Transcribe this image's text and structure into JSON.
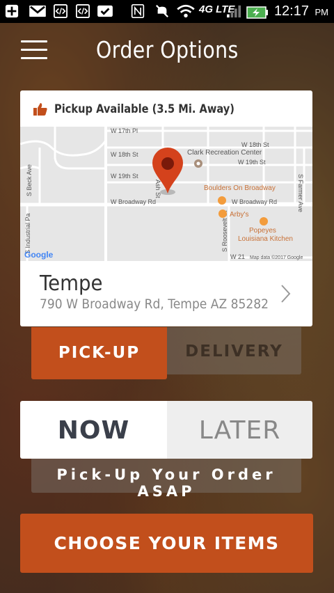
{
  "status_bar": {
    "time": "12:17",
    "ampm": "PM",
    "network": "4G LTE",
    "icons": [
      "add-icon",
      "gmail-icon",
      "code-icon",
      "code-icon",
      "check-icon",
      "nfc-icon",
      "mute-icon",
      "wifi-icon",
      "signal-icon",
      "battery-charging-icon"
    ]
  },
  "header": {
    "title": "Order Options",
    "menu_icon": "hamburger-menu-icon"
  },
  "card": {
    "availability": "Pickup Available (3.5 Mi. Away)",
    "availability_icon": "thumbs-up-icon",
    "map": {
      "streets": [
        "W 17th Pl",
        "W 18th St",
        "W 18th St",
        "W 19th St",
        "W 19th St",
        "W Broadway Rd",
        "W Broadway Rd",
        "S Beck Ave",
        "S Industrial Pa",
        "S Roosevelt St",
        "S Farmer Ave",
        "Ash St",
        "W 21"
      ],
      "places": [
        "Clark Recreation Center",
        "Boulders On Broadway",
        "Arby's",
        "Popeyes",
        "Louisiana Kitchen"
      ],
      "provider": "Google",
      "attribution": "Map data ©2017 Google"
    },
    "store_name": "Tempe",
    "store_address": "790 W Broadway Rd, Tempe AZ 85282"
  },
  "order_method": {
    "pickup_label": "PICK-UP",
    "delivery_label": "DELIVERY",
    "selected": "PICK-UP"
  },
  "order_time": {
    "now_label": "NOW",
    "later_label": "LATER",
    "selected": "NOW",
    "message": "Pick-Up Your Order ASAP"
  },
  "cta": {
    "label": "CHOOSE YOUR ITEMS"
  },
  "colors": {
    "accent": "#c24f1c",
    "pin": "#d4421c",
    "map_bg": "#e6e6e6"
  }
}
